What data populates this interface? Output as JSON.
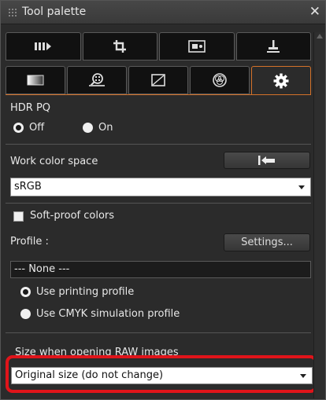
{
  "window": {
    "title": "Tool palette",
    "close_glyph": "✕"
  },
  "tabs_row1": [
    {
      "icon": "basic-adjust-icon",
      "active": false
    },
    {
      "icon": "crop-icon",
      "active": false
    },
    {
      "icon": "image-icon",
      "active": false
    },
    {
      "icon": "stamp-icon",
      "active": false
    }
  ],
  "tabs_row2": [
    {
      "icon": "tone-icon",
      "active": false
    },
    {
      "icon": "detail-zoom-icon",
      "active": false
    },
    {
      "icon": "curve-icon",
      "active": false
    },
    {
      "icon": "color-icon",
      "active": false
    },
    {
      "icon": "settings-gear-icon",
      "active": true
    }
  ],
  "hdr": {
    "label": "HDR PQ",
    "off_label": "Off",
    "on_label": "On",
    "selected": "Off"
  },
  "work_color_space": {
    "label": "Work color space",
    "value": "sRGB"
  },
  "softproof": {
    "label": "Soft-proof colors",
    "checked": false
  },
  "profile": {
    "label": "Profile :",
    "settings_label": "Settings...",
    "value": "--- None ---"
  },
  "simulation": {
    "option1": "Use printing profile",
    "option2": "Use CMYK simulation profile",
    "selected": "Use printing profile"
  },
  "raw_size": {
    "label": "Size when opening RAW images",
    "value": "Original size (do not change)"
  },
  "colors": {
    "accent": "#d4722a",
    "highlight": "#e0141a"
  }
}
